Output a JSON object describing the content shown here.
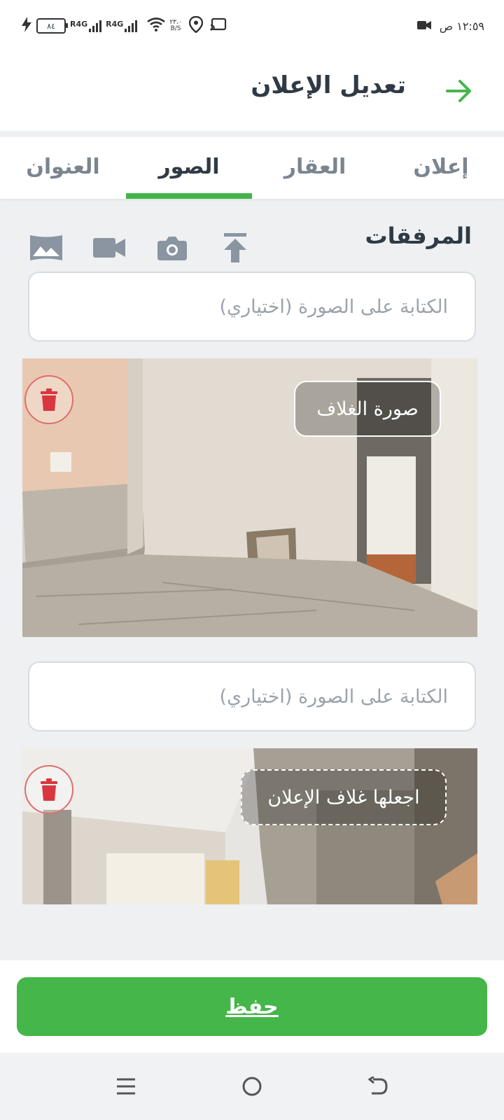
{
  "status_bar": {
    "time": "١٢:٥٩ ص",
    "battery": "٨٤",
    "network_1": "R4G",
    "network_2": "R4G",
    "speed_value": "٢٣،٠",
    "speed_unit": "B/S"
  },
  "header": {
    "title": "تعديل الإعلان"
  },
  "tabs": [
    {
      "label": "إعلان"
    },
    {
      "label": "العقار"
    },
    {
      "label": "الصور"
    },
    {
      "label": "العنوان"
    }
  ],
  "attachments": {
    "title": "المرفقات",
    "tools": [
      "upload-icon",
      "camera-icon",
      "video-camera-icon",
      "gallery-icon"
    ],
    "items": [
      {
        "caption_value": "",
        "caption_placeholder": "الكتابة على الصورة (اختياري)",
        "badge": "صورة الغلاف",
        "is_cover": true
      },
      {
        "caption_value": "",
        "caption_placeholder": "الكتابة على الصورة (اختياري)",
        "badge": "اجعلها غلاف الإعلان",
        "is_cover": false
      }
    ]
  },
  "save_label": "حفظ",
  "colors": {
    "accent": "#45b649",
    "delete": "#d9363e",
    "title": "#2f3a45"
  }
}
